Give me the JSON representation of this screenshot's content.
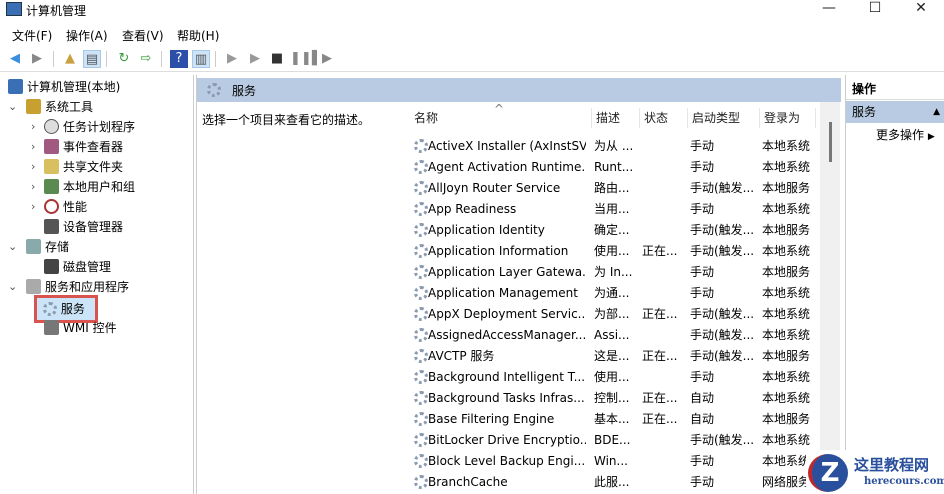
{
  "window": {
    "title": "计算机管理",
    "min": "—",
    "max": "☐",
    "close": "✕"
  },
  "menu": [
    "文件(F)",
    "操作(A)",
    "查看(V)",
    "帮助(H)"
  ],
  "tree": {
    "root": "计算机管理(本地)",
    "system_tools": "系统工具",
    "task_scheduler": "任务计划程序",
    "event_viewer": "事件查看器",
    "shared_folders": "共享文件夹",
    "local_users": "本地用户和组",
    "performance": "性能",
    "device_manager": "设备管理器",
    "storage": "存储",
    "disk_mgmt": "磁盘管理",
    "services_apps": "服务和应用程序",
    "services": "服务",
    "wmi": "WMI 控件"
  },
  "main": {
    "header": "服务",
    "description": "选择一个项目来查看它的描述。",
    "columns": [
      "名称",
      "描述",
      "状态",
      "启动类型",
      "登录为"
    ],
    "rows": [
      [
        "ActiveX Installer (AxInstSV)",
        "为从 ...",
        "",
        "手动",
        "本地系统"
      ],
      [
        "Agent Activation Runtime...",
        "Runt...",
        "",
        "手动",
        "本地系统"
      ],
      [
        "AllJoyn Router Service",
        "路由...",
        "",
        "手动(触发...",
        "本地服务"
      ],
      [
        "App Readiness",
        "当用...",
        "",
        "手动",
        "本地系统"
      ],
      [
        "Application Identity",
        "确定...",
        "",
        "手动(触发...",
        "本地服务"
      ],
      [
        "Application Information",
        "使用...",
        "正在...",
        "手动(触发...",
        "本地系统"
      ],
      [
        "Application Layer Gatewa...",
        "为 In...",
        "",
        "手动",
        "本地服务"
      ],
      [
        "Application Management",
        "为通...",
        "",
        "手动",
        "本地系统"
      ],
      [
        "AppX Deployment Servic...",
        "为部...",
        "正在...",
        "手动(触发...",
        "本地系统"
      ],
      [
        "AssignedAccessManager...",
        "Assi...",
        "",
        "手动(触发...",
        "本地系统"
      ],
      [
        "AVCTP 服务",
        "这是...",
        "正在...",
        "手动(触发...",
        "本地服务"
      ],
      [
        "Background Intelligent T...",
        "使用...",
        "",
        "手动",
        "本地系统"
      ],
      [
        "Background Tasks Infras...",
        "控制...",
        "正在...",
        "自动",
        "本地系统"
      ],
      [
        "Base Filtering Engine",
        "基本...",
        "正在...",
        "自动",
        "本地服务"
      ],
      [
        "BitLocker Drive Encryptio...",
        "BDE...",
        "",
        "手动(触发...",
        "本地系统"
      ],
      [
        "Block Level Backup Engi...",
        "Win...",
        "",
        "手动",
        "本地系统"
      ],
      [
        "BranchCache",
        "此服...",
        "",
        "手动",
        "网络服务"
      ]
    ]
  },
  "actions": {
    "header": "操作",
    "services": "服务",
    "more": "更多操作"
  },
  "watermark": {
    "title": "这里教程网",
    "url": "herecours.com"
  }
}
